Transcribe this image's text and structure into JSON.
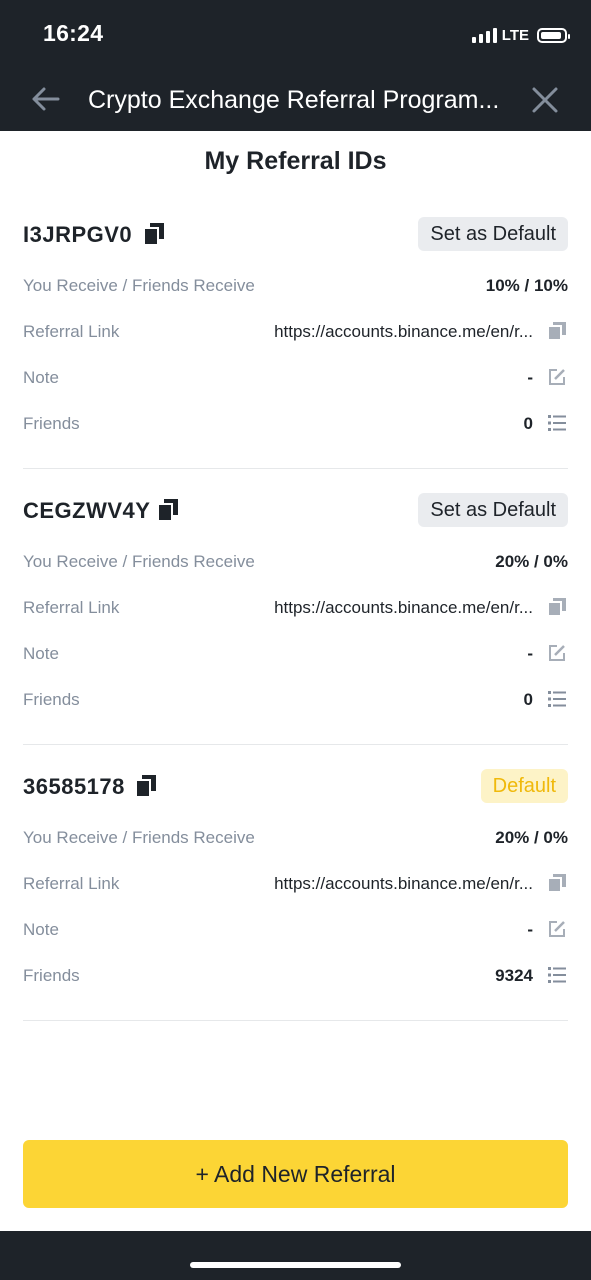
{
  "status_bar": {
    "time": "16:24",
    "network": "LTE"
  },
  "nav": {
    "title": "Crypto Exchange Referral Program..."
  },
  "page_title": "My Referral IDs",
  "labels": {
    "rates": "You Receive / Friends Receive",
    "link": "Referral Link",
    "note": "Note",
    "friends": "Friends"
  },
  "referrals": [
    {
      "id": "I3JRPGV0",
      "badge": "Set as Default",
      "rates": "10% / 10%",
      "link": "https://accounts.binance.me/en/r...",
      "note": "-",
      "friends": "0"
    },
    {
      "id": "CEGZWV4Y",
      "badge": "Set as Default",
      "rates": "20% / 0%",
      "link": "https://accounts.binance.me/en/r...",
      "note": "-",
      "friends": "0"
    },
    {
      "id": "36585178",
      "badge": "Default",
      "rates": "20% / 0%",
      "link": "https://accounts.binance.me/en/r...",
      "note": "-",
      "friends": "9324"
    }
  ],
  "add_button": "+ Add New Referral",
  "colors": {
    "brand_yellow": "#fcd535",
    "default_badge_text": "#f0b90b",
    "dark_bg": "#1e2329",
    "muted_text": "#848e9c"
  }
}
